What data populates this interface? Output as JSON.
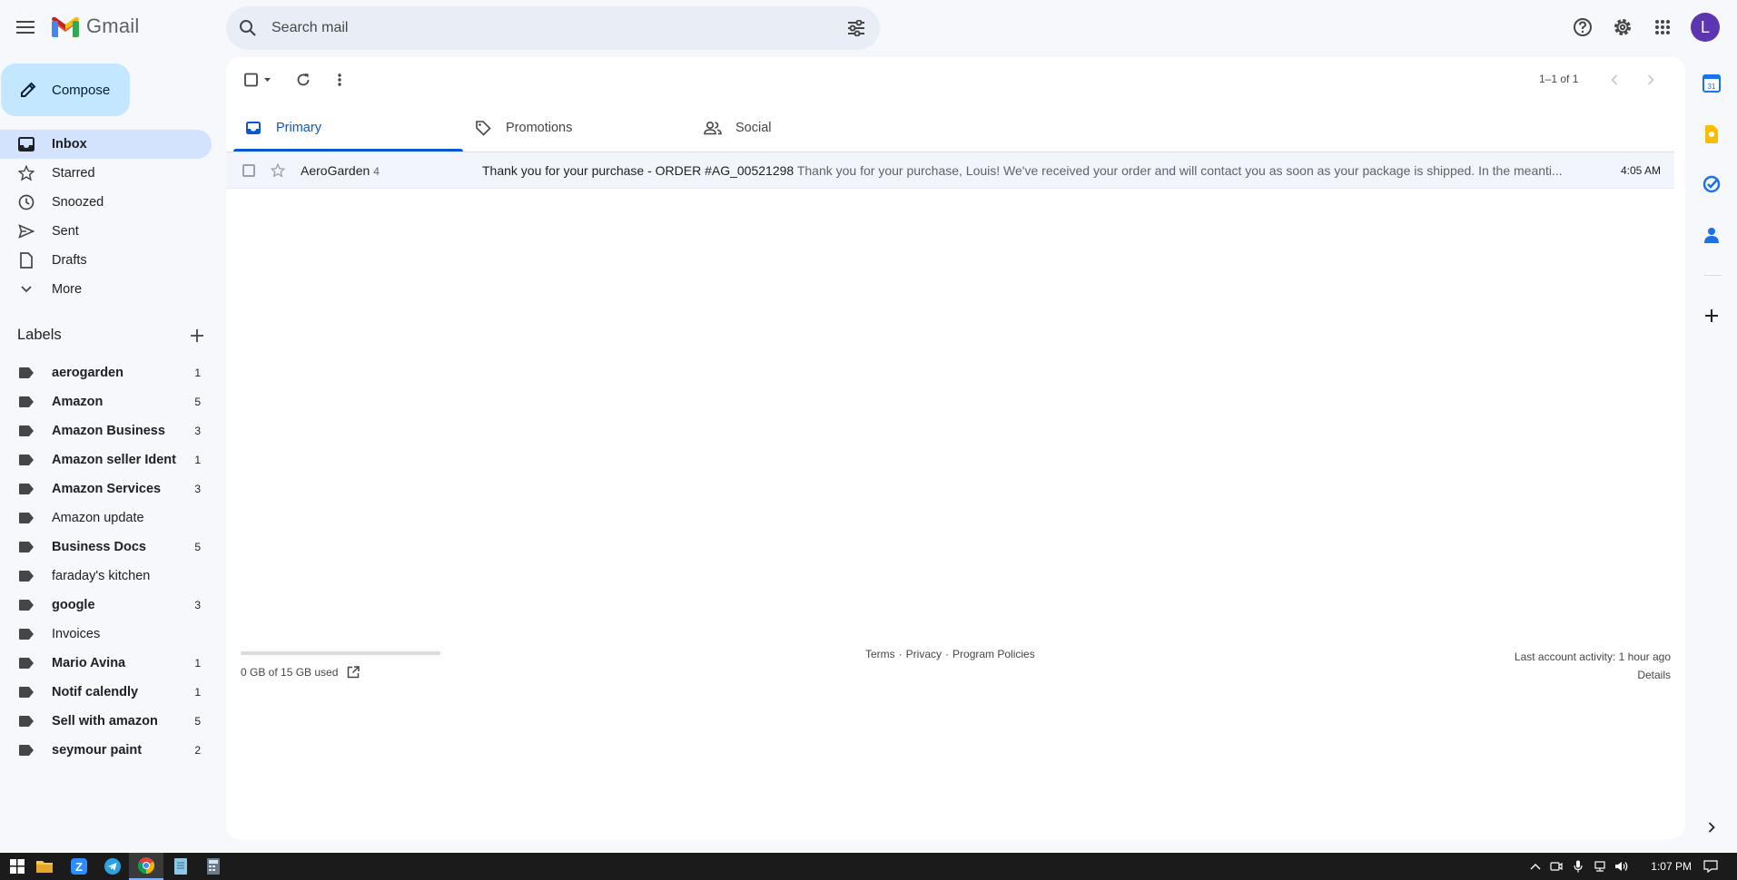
{
  "app": {
    "name": "Gmail",
    "search_placeholder": "Search mail",
    "avatar_letter": "L",
    "accent": "#0b57d0"
  },
  "sidebar": {
    "compose_label": "Compose",
    "nav": [
      {
        "label": "Inbox",
        "icon": "inbox-icon",
        "active": true
      },
      {
        "label": "Starred",
        "icon": "star-icon"
      },
      {
        "label": "Snoozed",
        "icon": "clock-icon"
      },
      {
        "label": "Sent",
        "icon": "send-icon"
      },
      {
        "label": "Drafts",
        "icon": "draft-icon"
      },
      {
        "label": "More",
        "icon": "chevron-down-icon"
      }
    ],
    "labels_title": "Labels",
    "labels": [
      {
        "name": "aerogarden",
        "count": "1",
        "bold": true
      },
      {
        "name": "Amazon",
        "count": "5",
        "bold": true
      },
      {
        "name": "Amazon Business",
        "count": "3",
        "bold": true
      },
      {
        "name": "Amazon seller Ident",
        "count": "1",
        "bold": true
      },
      {
        "name": "Amazon Services",
        "count": "3",
        "bold": true
      },
      {
        "name": "Amazon update",
        "count": "",
        "bold": false
      },
      {
        "name": "Business Docs",
        "count": "5",
        "bold": true
      },
      {
        "name": "faraday's kitchen",
        "count": "",
        "bold": false
      },
      {
        "name": "google",
        "count": "3",
        "bold": true
      },
      {
        "name": "Invoices",
        "count": "",
        "bold": false
      },
      {
        "name": "Mario Avina",
        "count": "1",
        "bold": true
      },
      {
        "name": "Notif calendly",
        "count": "1",
        "bold": true
      },
      {
        "name": "Sell with amazon",
        "count": "5",
        "bold": true
      },
      {
        "name": "seymour paint",
        "count": "2",
        "bold": true
      }
    ]
  },
  "main": {
    "pager": "1–1 of 1",
    "tabs": [
      {
        "label": "Primary",
        "icon": "inbox-tab-icon",
        "active": true
      },
      {
        "label": "Promotions",
        "icon": "tag-icon"
      },
      {
        "label": "Social",
        "icon": "people-icon"
      }
    ],
    "emails": [
      {
        "sender": "AeroGarden",
        "count": "4",
        "subject": "Thank you for your purchase - ORDER #AG_00521298",
        "snippet": " Thank you for your purchase, Louis! We've received your order and will contact you as soon as your package is shipped. In the meanti...",
        "time": "4:05 AM"
      }
    ],
    "storage": "0 GB of 15 GB used",
    "storage_fraction": 0.0,
    "footer_links": [
      "Terms",
      "·",
      "Privacy",
      "·",
      "Program Policies"
    ],
    "activity_line1": "Last account activity: 1 hour ago",
    "activity_line2": "Details"
  },
  "taskbar": {
    "time": "1:07 PM"
  }
}
